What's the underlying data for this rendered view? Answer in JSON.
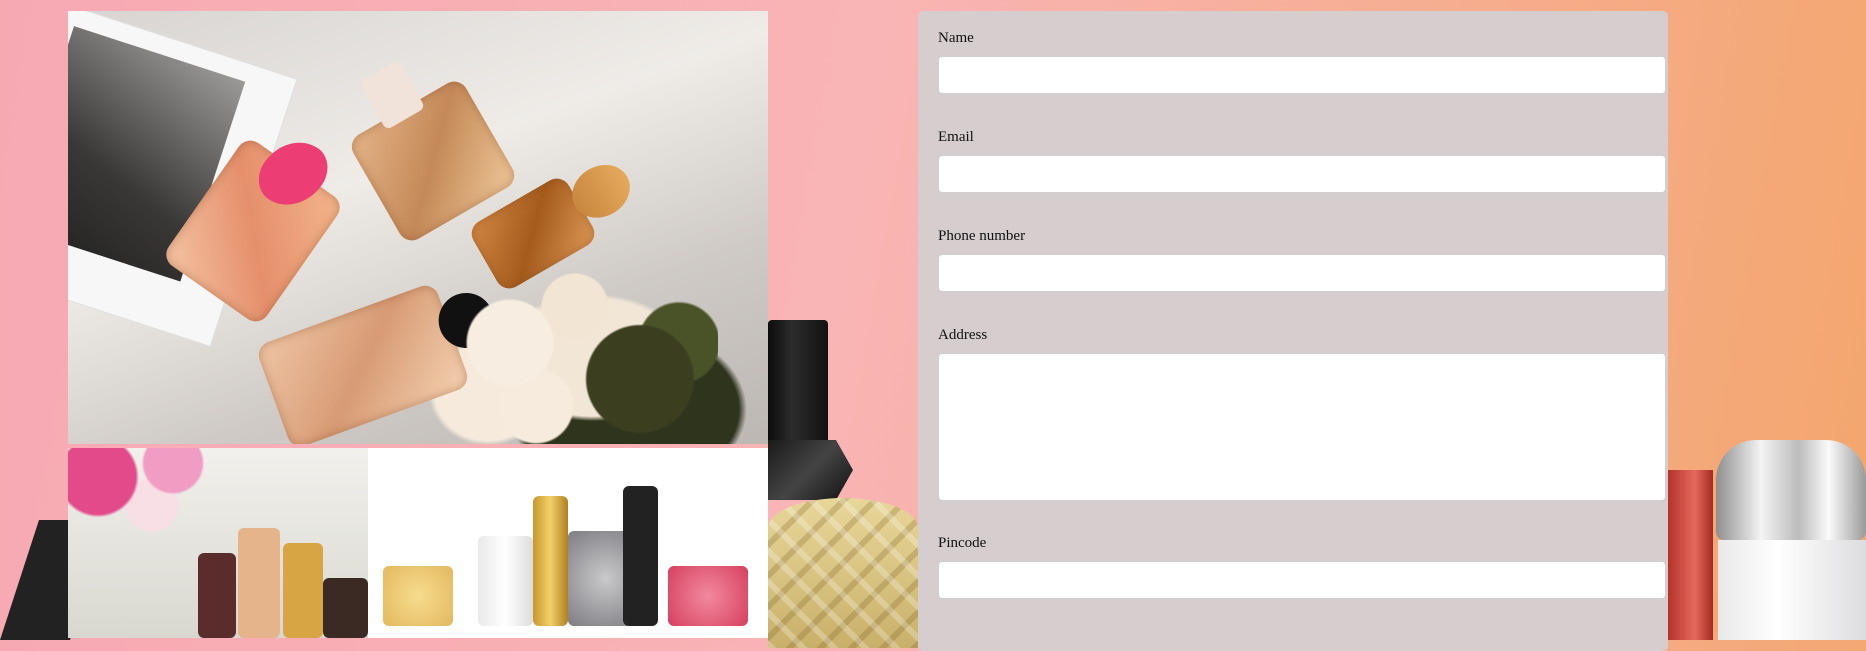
{
  "form": {
    "fields": [
      {
        "label": "Name",
        "value": "",
        "placeholder": ""
      },
      {
        "label": "Email",
        "value": "",
        "placeholder": ""
      },
      {
        "label": "Phone number",
        "value": "",
        "placeholder": ""
      },
      {
        "label": "Address",
        "value": "",
        "placeholder": ""
      },
      {
        "label": "Pincode",
        "value": "",
        "placeholder": ""
      }
    ]
  },
  "colors": {
    "panel_background": "#d6cdcf",
    "page_gradient_start": "#f7a9b3",
    "page_gradient_end": "#f3a66c"
  },
  "images": [
    {
      "name": "perfume-bottles-on-sheets-photo"
    },
    {
      "name": "perfume-and-flowers-photo"
    },
    {
      "name": "perfume-collection-product-photo"
    }
  ]
}
